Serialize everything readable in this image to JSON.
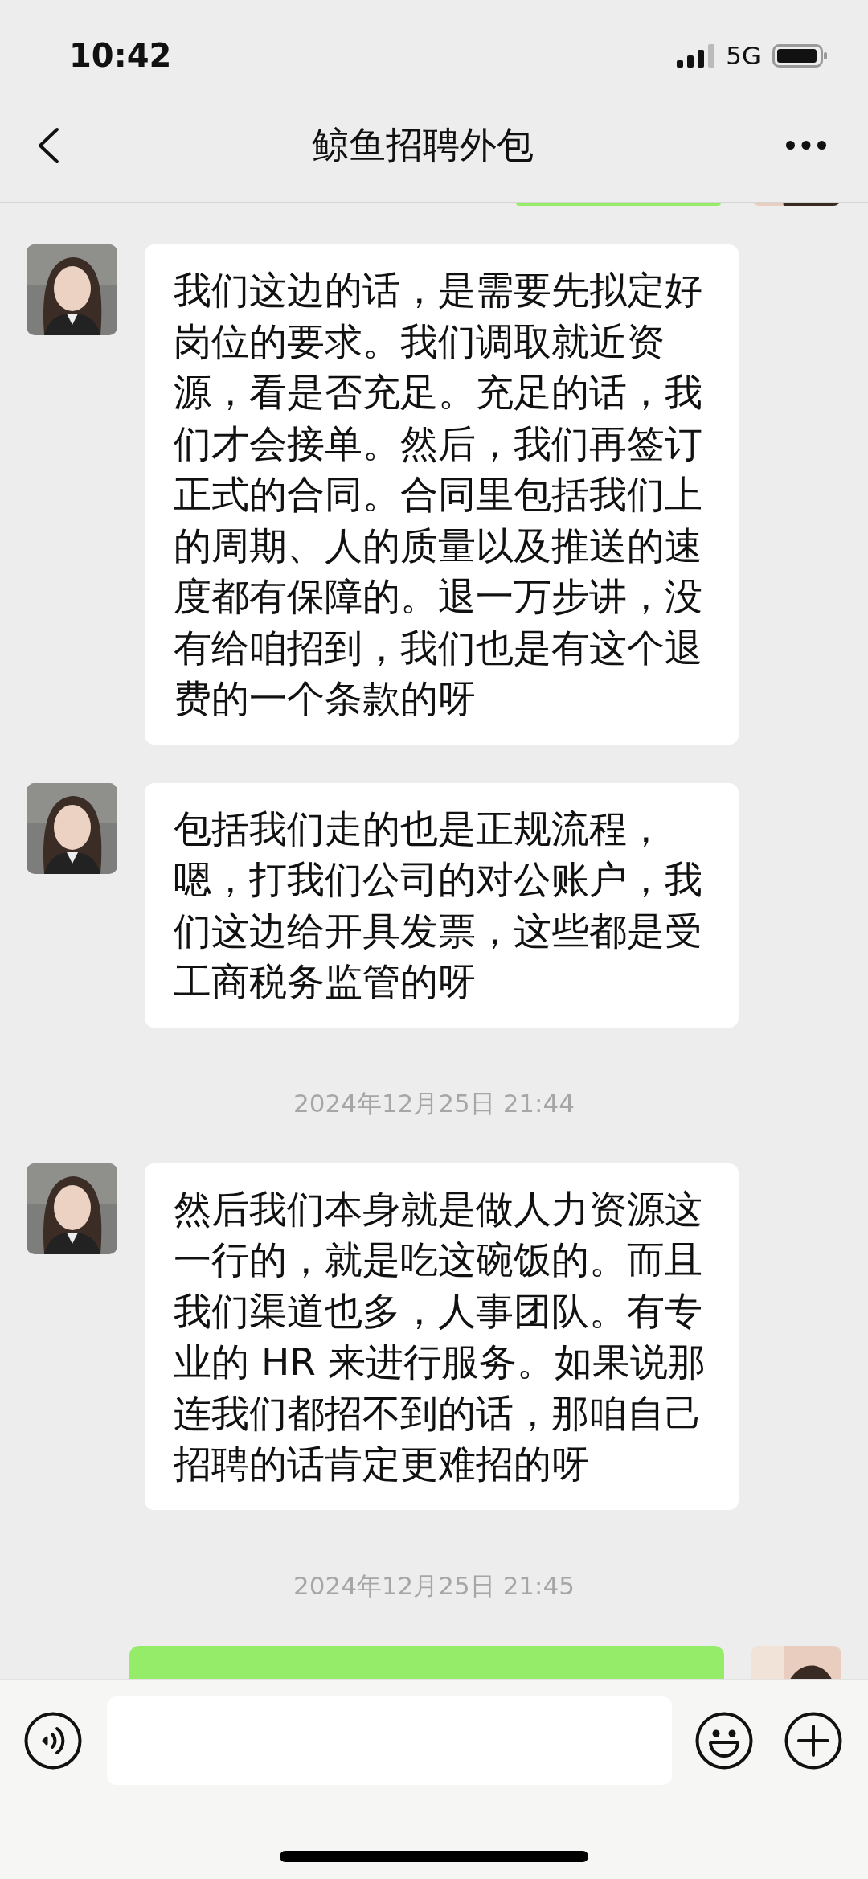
{
  "status_bar": {
    "time": "10:42",
    "network": "5G"
  },
  "header": {
    "title": "鲸鱼招聘外包"
  },
  "messages": [
    {
      "kind": "sent"
    },
    {
      "kind": "received",
      "text": "我们这边的话，是需要先拟定好岗位的要求。我们调取就近资源，看是否充足。充足的话，我们才会接单。然后，我们再签订正式的合同。合同里包括我们上的周期、人的质量以及推送的速度都有保障的。退一万步讲，没有给咱招到，我们也是有这个退费的一个条款的呀"
    },
    {
      "kind": "received",
      "text": "包括我们走的也是正规流程，嗯，打我们公司的对公账户，我们这边给开具发票，这些都是受工商税务监管的呀"
    },
    {
      "kind": "time",
      "text": "2024年12月25日 21:44"
    },
    {
      "kind": "received",
      "text": "然后我们本身就是做人力资源这一行的，就是吃这碗饭的。而且我们渠道也多，人事团队。有专业的 HR 来进行服务。如果说那连我们都招不到的话，那咱自己招聘的话肯定更难招的呀"
    },
    {
      "kind": "time",
      "text": "2024年12月25日 21:45"
    },
    {
      "kind": "sent"
    }
  ]
}
